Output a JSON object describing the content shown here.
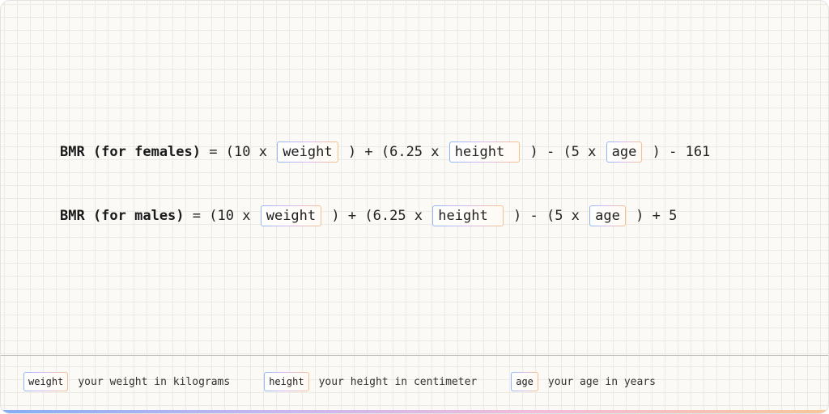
{
  "formulas": [
    {
      "label": "BMR (for females)",
      "parts": [
        "=",
        "(10 x",
        "weight",
        ")",
        "+",
        "(6.25 x",
        "height",
        ")",
        "-",
        "(5 x",
        "age",
        ")",
        "- 161"
      ]
    },
    {
      "label": "BMR (for males)",
      "parts": [
        "=",
        "(10 x",
        "weight",
        ")",
        "+",
        "(6.25 x",
        "height",
        ")",
        "-",
        "(5 x",
        "age",
        ")",
        "+ 5"
      ]
    }
  ],
  "legend": [
    {
      "term": "weight",
      "description": "your weight in kilograms"
    },
    {
      "term": "height",
      "description": "your height in centimeter"
    },
    {
      "term": "age",
      "description": "your age in years"
    }
  ],
  "colors": {
    "box_gradient": [
      "#8fb5f6",
      "#d9b8ee",
      "#f5c190"
    ],
    "bottom_bar_gradient": [
      "#86aef4",
      "#c8b6f0",
      "#f4bcd8",
      "#f7c79a"
    ],
    "grid_line": "#eceae2"
  }
}
